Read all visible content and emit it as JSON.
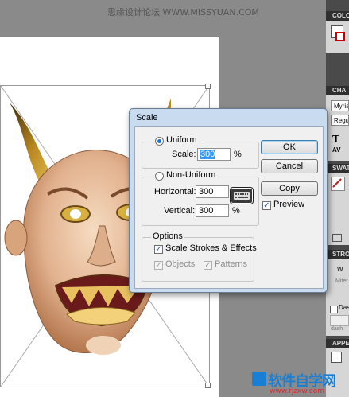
{
  "watermark": "思缘设计论坛  WWW.MISSYUAN.COM",
  "dialog": {
    "title": "Scale",
    "uniform_label": "Uniform",
    "scale_label": "Scale:",
    "scale_value": "300",
    "percent": "%",
    "non_uniform_label": "Non-Uniform",
    "horizontal_label": "Horizontal:",
    "horizontal_value": "300",
    "vertical_label": "Vertical:",
    "vertical_value": "300",
    "options_label": "Options",
    "scale_strokes_label": "Scale Strokes & Effects",
    "objects_label": "Objects",
    "patterns_label": "Patterns",
    "ok_label": "OK",
    "cancel_label": "Cancel",
    "copy_label": "Copy",
    "preview_label": "Preview",
    "uniform_selected": true,
    "scale_strokes_checked": true,
    "objects_checked": true,
    "patterns_checked": true,
    "preview_checked": true
  },
  "panel": {
    "color_tab": "COLO",
    "character_tab": "CHA",
    "font_name": "Myria",
    "font_style": "Regu",
    "swatches_tab": "SWAT",
    "stroke_tab": "STRO",
    "stroke_label_w": "W",
    "stroke_miter": "Miter",
    "stroke_dash_label": "Das",
    "stroke_dash_word": "dash",
    "appearance_tab": "APPE"
  },
  "logo": {
    "main": "软件自学网",
    "url": "www.rjzxw.com"
  },
  "colors": {
    "dialog_frame": "#c9dcef",
    "selection": "#3399ff",
    "logo_blue": "#1a7fd4",
    "logo_red": "#e0262b"
  }
}
